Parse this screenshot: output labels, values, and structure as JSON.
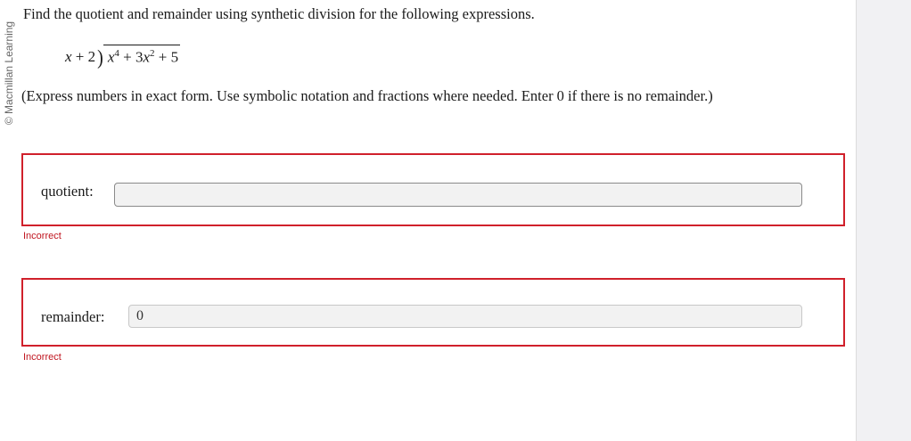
{
  "copyright": "© Macmillan Learning",
  "question": {
    "prompt": "Find the quotient and remainder using synthetic division for the following expressions.",
    "divisor_var": "x",
    "divisor_rest": " + 2",
    "bracket": ")",
    "dividend": {
      "term1_var": "x",
      "term1_exp": "4",
      "plus1": " + 3",
      "term2_var": "x",
      "term2_exp": "2",
      "plus2": " + 5"
    },
    "instructions": "(Express numbers in exact form. Use symbolic notation and fractions where needed. Enter 0 if there is no remainder.)"
  },
  "answers": [
    {
      "label": "quotient:",
      "value": "",
      "status": "Incorrect"
    },
    {
      "label": "remainder:",
      "value": "0",
      "status": "Incorrect"
    }
  ],
  "colors": {
    "error": "#d0202b",
    "error_text": "#c0151f",
    "input_bg": "#f2f2f2",
    "side_panel": "#f1f1f3"
  }
}
